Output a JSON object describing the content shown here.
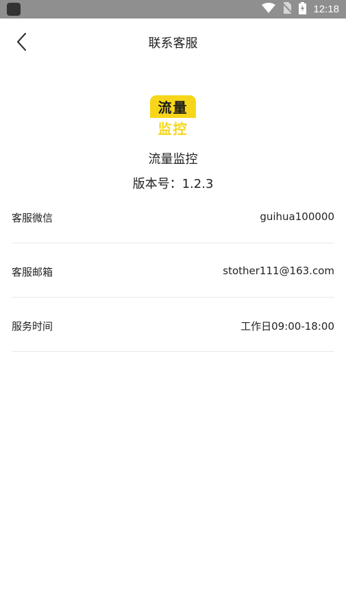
{
  "status_bar": {
    "time": "12:18",
    "icons": [
      "app-notification-icon",
      "wifi-icon",
      "no-sim-icon",
      "battery-charging-icon"
    ]
  },
  "header": {
    "title": "联系客服",
    "back_icon": "chevron-left-icon"
  },
  "app": {
    "logo_line1": "流量",
    "logo_line2": "监控",
    "name": "流量监控",
    "version": "版本号：1.2.3",
    "logo_color": "#f7d619"
  },
  "info": [
    {
      "label": "客服微信",
      "value": "guihua100000"
    },
    {
      "label": "客服邮箱",
      "value": "stother111@163.com"
    },
    {
      "label": "服务时间",
      "value": "工作日09:00-18:00"
    }
  ]
}
